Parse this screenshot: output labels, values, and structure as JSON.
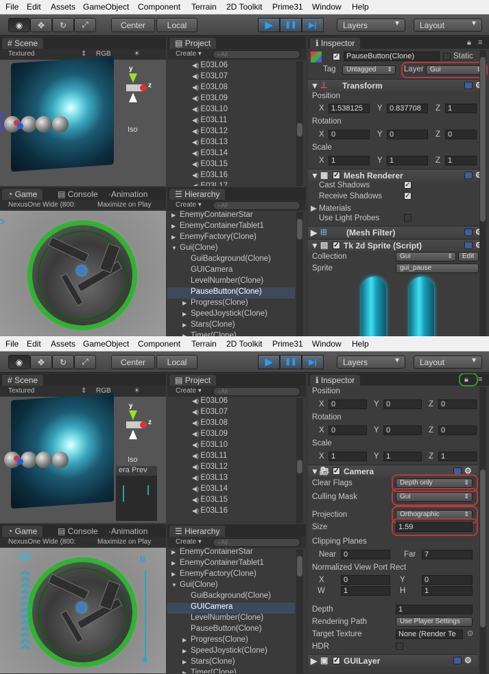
{
  "menu": [
    "File",
    "Edit",
    "Assets",
    "GameObject",
    "Component",
    "Terrain",
    "2D Toolkit",
    "Prime31",
    "Window",
    "Help"
  ],
  "toolbar": {
    "center": "Center",
    "local": "Local",
    "layers": "Layers",
    "layout": "Layout",
    "play": "▶",
    "pause": "❚❚",
    "step": "▶|"
  },
  "tabs": {
    "scene": "Scene",
    "project": "Project",
    "inspector": "Inspector",
    "game": "Game",
    "console": "Console",
    "animation": "Animation",
    "hierarchy": "Hierarchy"
  },
  "scene_sub": {
    "textured": "Textured",
    "rgb": "RGB",
    "iso": "Iso",
    "axis_y": "y",
    "axis_z": "z"
  },
  "project_sub": {
    "create": "Create ▾",
    "search": "All"
  },
  "game_sub": {
    "aspect": "NexusOne Wide (800:",
    "maximize": "Maximize on Play"
  },
  "camera_preview_title": "era Prev",
  "project_items_top": [
    "E03L06",
    "E03L07",
    "E03L08",
    "E03L09",
    "E03L10",
    "E03L11",
    "E03L12",
    "E03L13",
    "E03L14",
    "E03L15",
    "E03L16",
    "E03L17"
  ],
  "project_items_bottom": [
    "E03L06",
    "E03L07",
    "E03L08",
    "E03L09",
    "E03L10",
    "E03L11",
    "E03L12",
    "E03L13",
    "E03L14",
    "E03L15",
    "E03L16"
  ],
  "hierarchy": {
    "items": [
      {
        "label": "EnemyContainerStar",
        "indent": 0
      },
      {
        "label": "EnemyContainerTablet1",
        "indent": 0
      },
      {
        "label": "EnemyFactory(Clone)",
        "indent": 0
      },
      {
        "label": "Gui(Clone)",
        "indent": 0,
        "arrow": "▼"
      },
      {
        "label": "GuiBackground(Clone)",
        "indent": 1
      },
      {
        "label": "GUICamera",
        "indent": 1
      },
      {
        "label": "LevelNumber(Clone)",
        "indent": 1
      },
      {
        "label": "PauseButton(Clone)",
        "indent": 1
      },
      {
        "label": "Progress(Clone)",
        "indent": 1,
        "arrow": "▶"
      },
      {
        "label": "SpeedJoystick(Clone)",
        "indent": 1,
        "arrow": "▶"
      },
      {
        "label": "Stars(Clone)",
        "indent": 1,
        "arrow": "▶"
      },
      {
        "label": "Timer(Clone)",
        "indent": 1,
        "arrow": "▶"
      }
    ],
    "selected_top": "PauseButton(Clone)",
    "selected_bottom": "GUICamera"
  },
  "inspector_top": {
    "object_name": "PauseButton(Clone)",
    "static_label": "Static",
    "tag_label": "Tag",
    "tag_value": "Untagged",
    "layer_label": "Layer",
    "layer_value": "Gui",
    "transform": "Transform",
    "position": "Position",
    "rotation": "Rotation",
    "scale": "Scale",
    "pos": {
      "x": "1.538125",
      "y": "0.837708",
      "z": "1"
    },
    "rot": {
      "x": "0",
      "y": "0",
      "z": "0"
    },
    "scl": {
      "x": "1",
      "y": "1",
      "z": "1"
    },
    "mesh_renderer": "Mesh Renderer",
    "cast_shadows": "Cast Shadows",
    "receive_shadows": "Receive Shadows",
    "materials": "Materials",
    "use_light_probes": "Use Light Probes",
    "mesh_filter": "(Mesh Filter)",
    "sprite_component": "Tk 2d Sprite (Script)",
    "collection_label": "Collection",
    "collection_value": "Gui",
    "edit": "Edit",
    "sprite_label": "Sprite",
    "sprite_value": "gui_pause"
  },
  "inspector_bottom": {
    "position": "Position",
    "rotation": "Rotation",
    "scale": "Scale",
    "pos": {
      "x": "0",
      "y": "0",
      "z": "0"
    },
    "rot": {
      "x": "0",
      "y": "0",
      "z": "0"
    },
    "scl": {
      "x": "1",
      "y": "1",
      "z": "1"
    },
    "camera": "Camera",
    "clear_flags_label": "Clear Flags",
    "clear_flags_value": "Depth only",
    "culling_mask_label": "Culling Mask",
    "culling_mask_value": "Gui",
    "projection_label": "Projection",
    "projection_value": "Orthographic",
    "size_label": "Size",
    "size_value": "1.59",
    "clipping_label": "Clipping Planes",
    "near_label": "Near",
    "near_value": "0",
    "far_label": "Far",
    "far_value": "7",
    "viewport_label": "Normalized View Port Rect",
    "vp": {
      "x": "0",
      "y": "0",
      "w": "1",
      "h": "1"
    },
    "depth_label": "Depth",
    "depth_value": "1",
    "rendering_path_label": "Rendering Path",
    "rendering_path_value": "Use Player Settings",
    "target_texture_label": "Target Texture",
    "target_texture_value": "None (Render Te",
    "hdr_label": "HDR",
    "gui_layer": "GUILayer"
  },
  "game_hud": {
    "score": "58",
    "pause": "II"
  },
  "colors": {
    "highlight_red": "#b83a3a",
    "highlight_green": "#2ca02c",
    "play_blue": "#2a9cf0",
    "ring_green": "#2db52d"
  }
}
